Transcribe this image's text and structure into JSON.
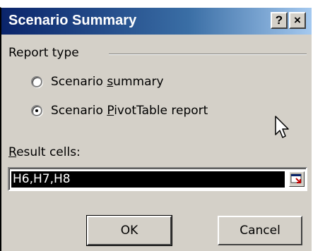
{
  "dialog": {
    "title": "Scenario Summary",
    "help_glyph": "?",
    "close_glyph": "×",
    "group_label": "Report type",
    "options": [
      {
        "label_pre": "Scenario ",
        "label_ul": "s",
        "label_post": "ummary",
        "checked": false
      },
      {
        "label_pre": "Scenario ",
        "label_ul": "P",
        "label_post": "ivotTable report",
        "checked": true
      }
    ],
    "result_label_ul": "R",
    "result_label_rest": "esult cells:",
    "result_value": "H6,H7,H8",
    "ok_label": "OK",
    "cancel_label": "Cancel"
  },
  "colors": {
    "title_start": "#0a246a",
    "title_end": "#a6caf0",
    "face": "#d4d0c8"
  },
  "icons": {
    "cursor": "arrow-pointer-icon",
    "collapse": "collapse-dialog-icon"
  }
}
